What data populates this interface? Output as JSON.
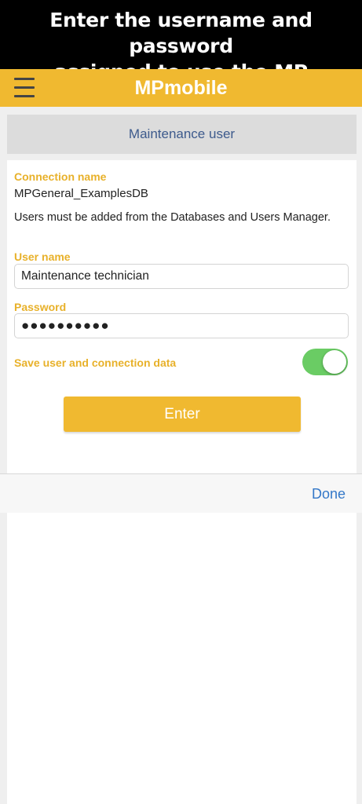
{
  "banner": {
    "line1": "Enter the username and password",
    "line2": "assigned to use the MP"
  },
  "appbar": {
    "menu_icon": "hamburger-menu-icon",
    "title": "MPmobile"
  },
  "section": {
    "title": "Maintenance user"
  },
  "form": {
    "connection_label": "Connection name",
    "connection_value": "MPGeneral_ExamplesDB",
    "note": "Users must be added from the Databases and Users Manager.",
    "username_label": "User name",
    "username_value": "Maintenance technician",
    "password_label": "Password",
    "password_value": "●●●●●●●●●●",
    "save_label": "Save user and connection data",
    "save_toggle_on": true,
    "enter_label": "Enter"
  },
  "keyboard_toolbar": {
    "done_label": "Done"
  },
  "colors": {
    "brand": "#f0b930",
    "label": "#e8b12a",
    "section_text": "#3d5a8c",
    "toggle_on": "#6acc64",
    "link": "#3478c8"
  }
}
